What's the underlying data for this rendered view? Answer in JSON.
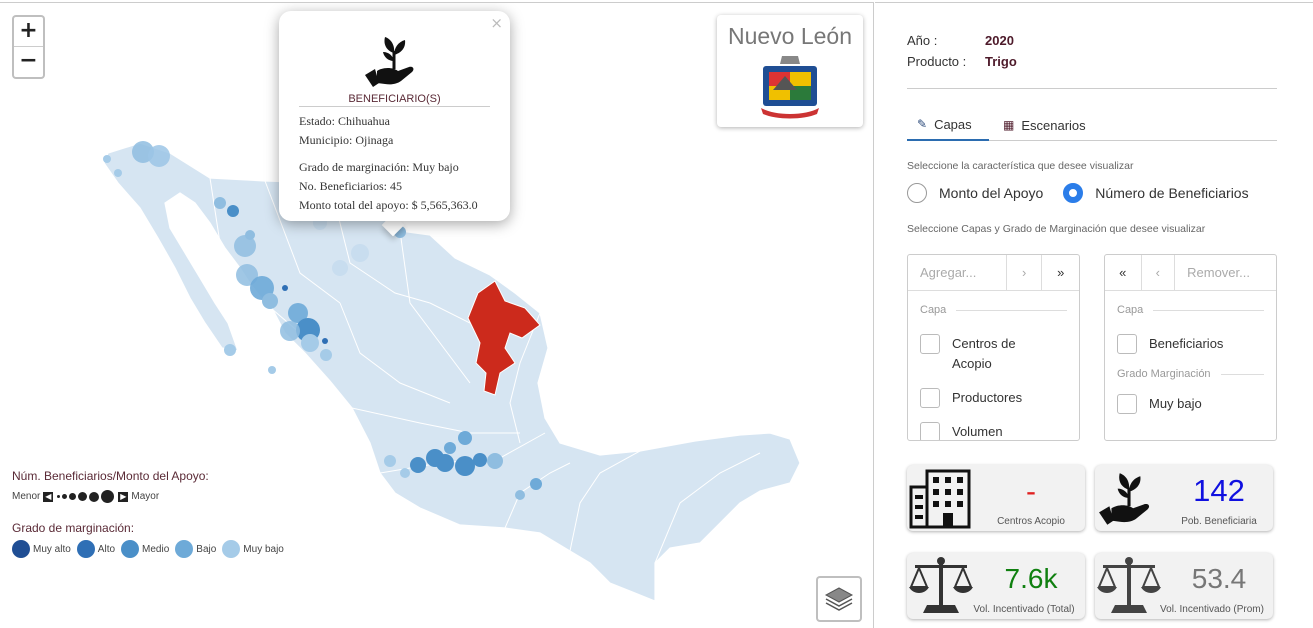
{
  "map": {
    "zoom_in": "+",
    "zoom_out": "−",
    "state_card_title": "Nuevo León",
    "popup": {
      "close": "×",
      "title": "BENEFICIARIO(S)",
      "estado": "Estado: Chihuahua",
      "municipio": "Municipio: Ojinaga",
      "grado": "Grado de marginación: Muy bajo",
      "beneficiarios": "No. Beneficiarios: 45",
      "monto": "Monto total del apoyo: $ 5,565,363.0"
    },
    "legend": {
      "size_title": "Núm. Beneficiarios/Monto del Apoyo:",
      "menor": "Menor",
      "mayor": "Mayor",
      "marg_title": "Grado de marginación:",
      "levels": [
        {
          "label": "Muy alto",
          "color": "#1f4e94"
        },
        {
          "label": "Alto",
          "color": "#2f6fb5"
        },
        {
          "label": "Medio",
          "color": "#4a8fc8"
        },
        {
          "label": "Bajo",
          "color": "#6eaad8"
        },
        {
          "label": "Muy bajo",
          "color": "#a5cbe8"
        }
      ]
    },
    "colors": {
      "land": "#d6e5f2",
      "highlight": "#cc2a1c",
      "border": "#ffffff"
    }
  },
  "panel": {
    "anio_label": "Año :",
    "anio_value": "2020",
    "producto_label": "Producto :",
    "producto_value": "Trigo",
    "tabs": [
      {
        "label": "Capas",
        "icon": "brush-icon",
        "active": true
      },
      {
        "label": "Escenarios",
        "icon": "grid-icon",
        "active": false
      }
    ],
    "hint1": "Seleccione la característica que desee visualizar",
    "radio_monto": "Monto del Apoyo",
    "radio_numero": "Número de Beneficiarios",
    "hint2": "Seleccione Capas y Grado de Marginación que desee visualizar",
    "left_list": {
      "placeholder": "Agregar...",
      "btn_one": "›",
      "btn_all": "»",
      "section": "Capa",
      "items": [
        "Centros de Acopio",
        "Productores",
        "Volumen"
      ]
    },
    "right_list": {
      "btn_all": "«",
      "btn_one": "‹",
      "placeholder": "Remover...",
      "section1": "Capa",
      "items1": [
        "Beneficiarios"
      ],
      "section2": "Grado Marginación",
      "items2": [
        "Muy bajo"
      ]
    },
    "cards": {
      "centros_value": "-",
      "centros_label": "Centros Acopio",
      "pob_value": "142",
      "pob_label": "Pob. Beneficiaria",
      "vol_total_value": "7.6k",
      "vol_total_label": "Vol. Incentivado (Total)",
      "vol_prom_value": "53.4",
      "vol_prom_label": "Vol. Incentivado (Prom)"
    }
  }
}
